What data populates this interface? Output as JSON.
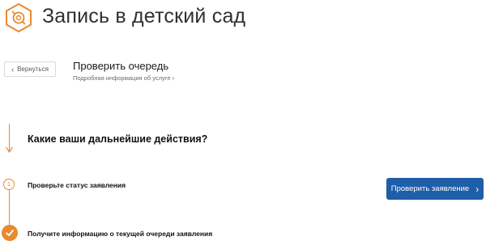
{
  "header": {
    "title": "Запись в детский сад",
    "logo_icon": "pacifier-icon"
  },
  "service": {
    "back_label": "Вернуться",
    "title": "Проверить очередь",
    "details_link": "Подробная информация об услуге"
  },
  "actions": {
    "question": "Какие ваши дальнейшие действия?",
    "steps": [
      {
        "number": "1",
        "label": "Проверьте статус заявления",
        "button_label": "Проверить заявление"
      },
      {
        "icon": "check-icon",
        "label": "Получите информацию о текущей очереди заявления"
      }
    ]
  },
  "colors": {
    "accent": "#e8892f",
    "primary_button": "#1f5ea8"
  }
}
